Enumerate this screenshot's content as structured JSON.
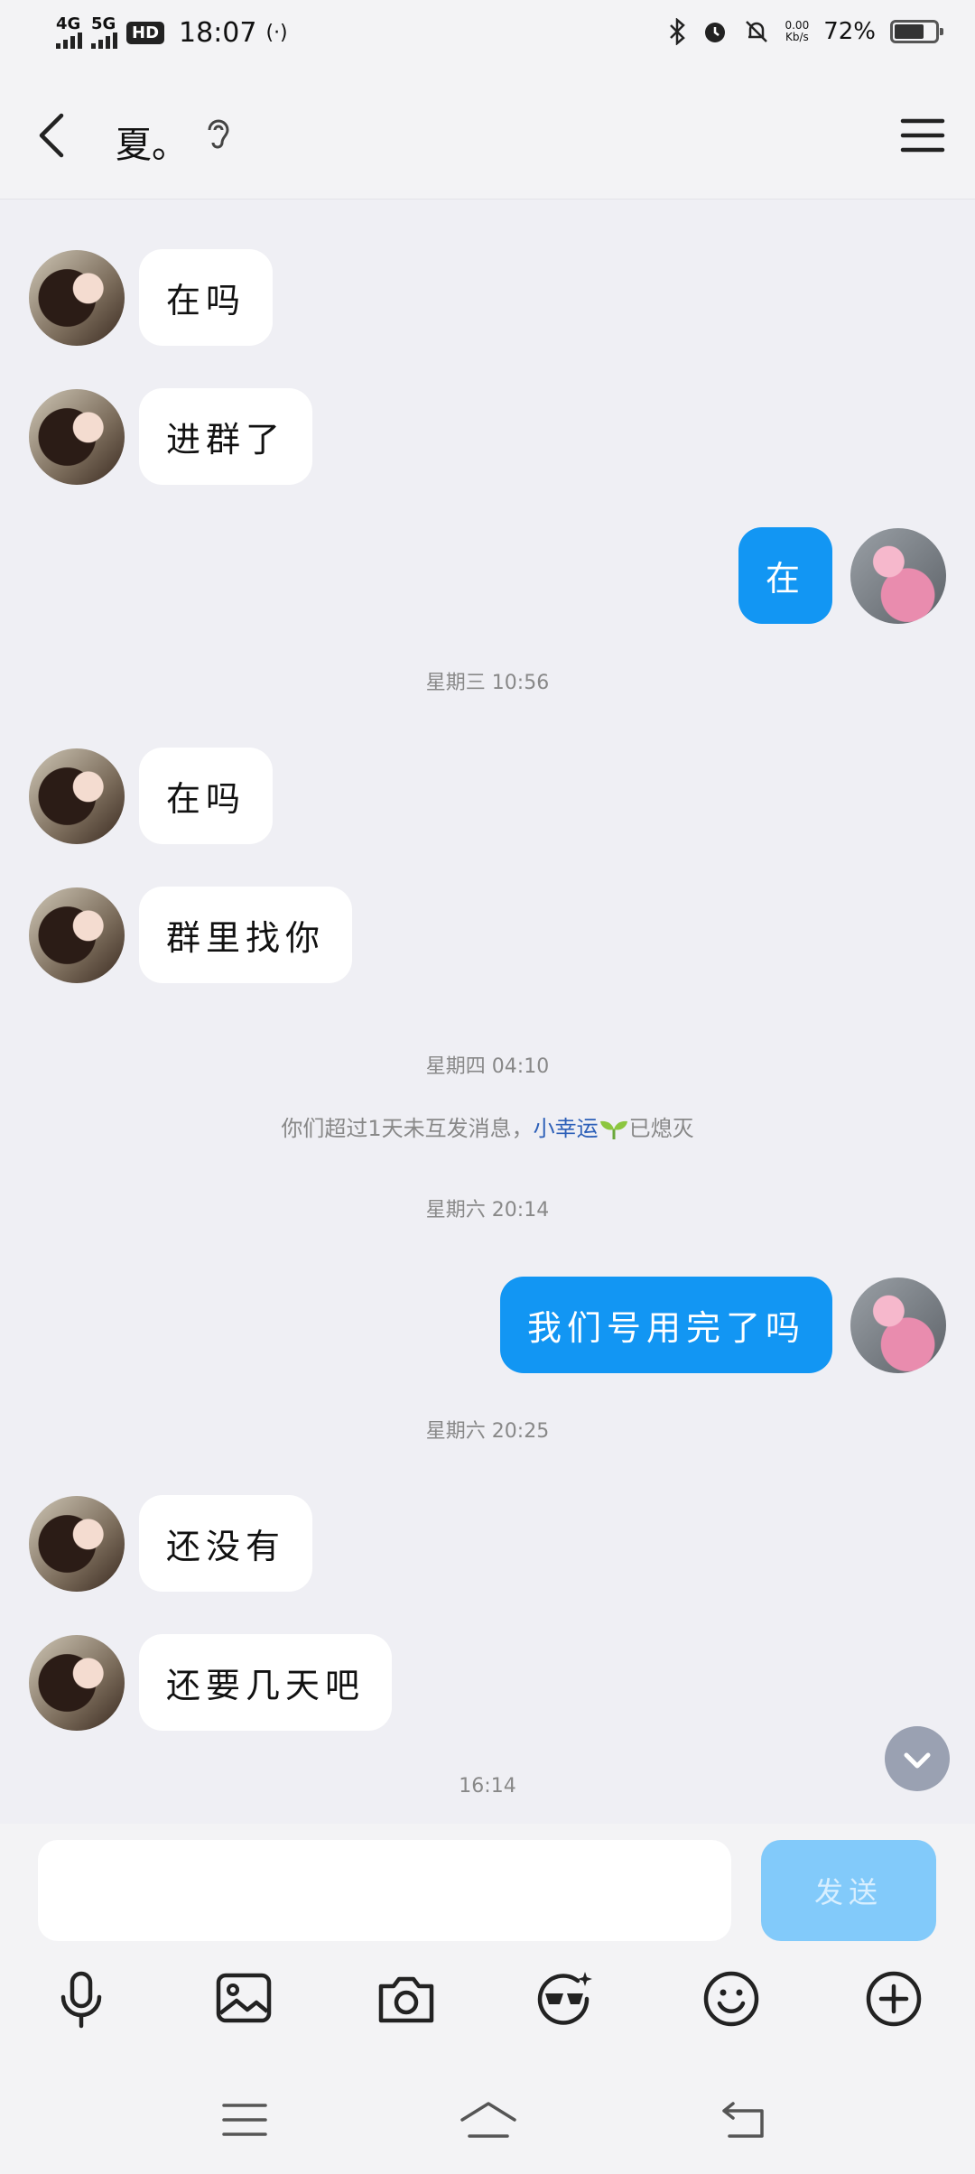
{
  "status_bar": {
    "network1": "4G",
    "network2": "5G",
    "hd": "HD",
    "time": "18:07",
    "net_speed": "0.00\nKb/s",
    "battery": "72%",
    "battery_level": 0.72
  },
  "header": {
    "title": "夏。"
  },
  "messages": [
    {
      "text": "在吗"
    },
    {
      "text": "进群了"
    },
    {
      "text": "在"
    },
    {
      "text": "在吗"
    },
    {
      "text": "群里找你"
    },
    {
      "text": "我们号用完了吗"
    },
    {
      "text": "还没有"
    },
    {
      "text": "还要几天吧"
    }
  ],
  "timestamps": [
    "星期三 10:56",
    "星期四 04:10",
    "星期六 20:14",
    "星期六 20:25",
    "16:14"
  ],
  "system_message": {
    "before": "你们超过1天未互发消息，",
    "link": "小幸运",
    "after": "已熄灭"
  },
  "input": {
    "placeholder": "",
    "send_label": "发送"
  },
  "colors": {
    "accent": "#1296f3",
    "send_disabled": "#82cafa",
    "background": "#efeff4"
  },
  "icons": [
    "microphone-icon",
    "image-icon",
    "camera-icon",
    "sticker-icon",
    "emoji-icon",
    "plus-icon"
  ]
}
